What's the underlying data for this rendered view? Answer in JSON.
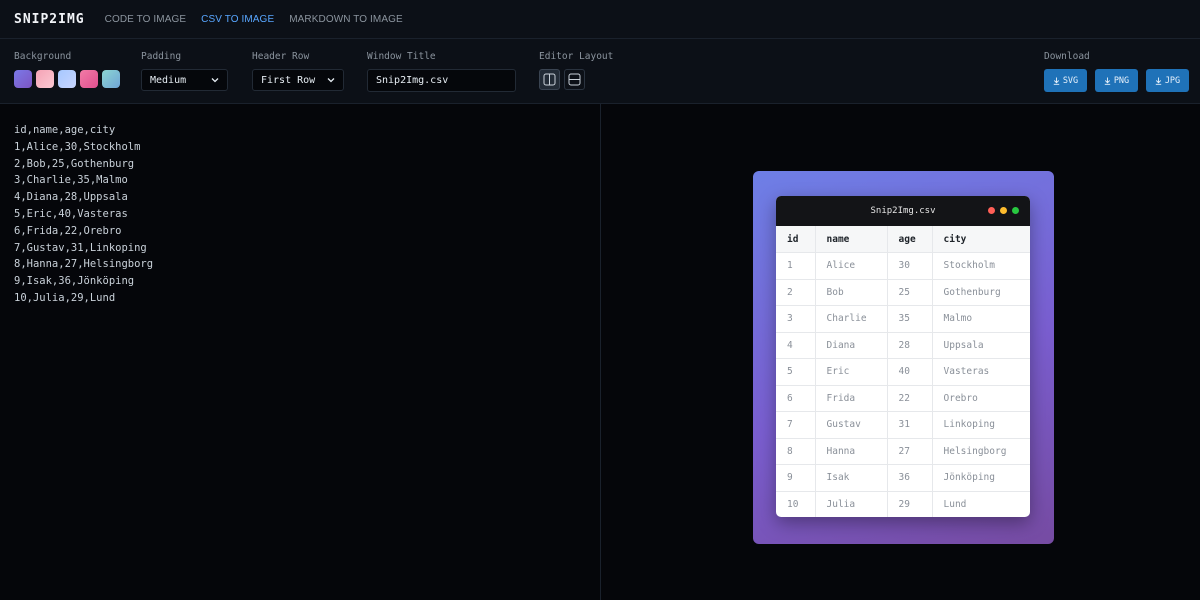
{
  "app": {
    "logo": "SNIP2IMG"
  },
  "nav": [
    {
      "label": "CODE TO IMAGE",
      "active": false
    },
    {
      "label": "CSV TO IMAGE",
      "active": true
    },
    {
      "label": "MARKDOWN TO IMAGE",
      "active": false
    }
  ],
  "toolbar": {
    "background_label": "Background",
    "background_swatches": [
      {
        "name": "indigo-purple",
        "from": "#7b79e8",
        "to": "#7c55c2"
      },
      {
        "name": "pink-blush",
        "from": "#f5a3b5",
        "to": "#fbc8d3"
      },
      {
        "name": "sky-lavender",
        "from": "#a6c8ff",
        "to": "#c8d5ff"
      },
      {
        "name": "pink-magenta",
        "from": "#f27ba6",
        "to": "#e04f8f"
      },
      {
        "name": "mint-teal",
        "from": "#8cd6d2",
        "to": "#6fa4d6"
      }
    ],
    "padding_label": "Padding",
    "padding_value": "Medium",
    "header_row_label": "Header Row",
    "header_row_value": "First Row",
    "window_title_label": "Window Title",
    "window_title_value": "Snip2Img.csv",
    "editor_layout_label": "Editor Layout",
    "download_label": "Download",
    "download_buttons": [
      "SVG",
      "PNG",
      "JPG"
    ]
  },
  "editor": {
    "lines": [
      "id,name,age,city",
      "1,Alice,30,Stockholm",
      "2,Bob,25,Gothenburg",
      "3,Charlie,35,Malmo",
      "4,Diana,28,Uppsala",
      "5,Eric,40,Vasteras",
      "6,Frida,22,Orebro",
      "7,Gustav,31,Linkoping",
      "8,Hanna,27,Helsingborg",
      "9,Isak,36,Jönköping",
      "10,Julia,29,Lund"
    ]
  },
  "preview": {
    "window_title": "Snip2Img.csv",
    "traffic_lights": [
      "#ff5f57",
      "#febc2e",
      "#28c840"
    ],
    "headers": [
      "id",
      "name",
      "age",
      "city"
    ],
    "rows": [
      [
        "1",
        "Alice",
        "30",
        "Stockholm"
      ],
      [
        "2",
        "Bob",
        "25",
        "Gothenburg"
      ],
      [
        "3",
        "Charlie",
        "35",
        "Malmo"
      ],
      [
        "4",
        "Diana",
        "28",
        "Uppsala"
      ],
      [
        "5",
        "Eric",
        "40",
        "Vasteras"
      ],
      [
        "6",
        "Frida",
        "22",
        "Orebro"
      ],
      [
        "7",
        "Gustav",
        "31",
        "Linkoping"
      ],
      [
        "8",
        "Hanna",
        "27",
        "Helsingborg"
      ],
      [
        "9",
        "Isak",
        "36",
        "Jönköping"
      ],
      [
        "10",
        "Julia",
        "29",
        "Lund"
      ]
    ]
  },
  "colors": {
    "accent": "#58a6ff",
    "download_button": "#1f72b8",
    "background_gradient": [
      "#6e7fe6",
      "#764ba2"
    ]
  }
}
